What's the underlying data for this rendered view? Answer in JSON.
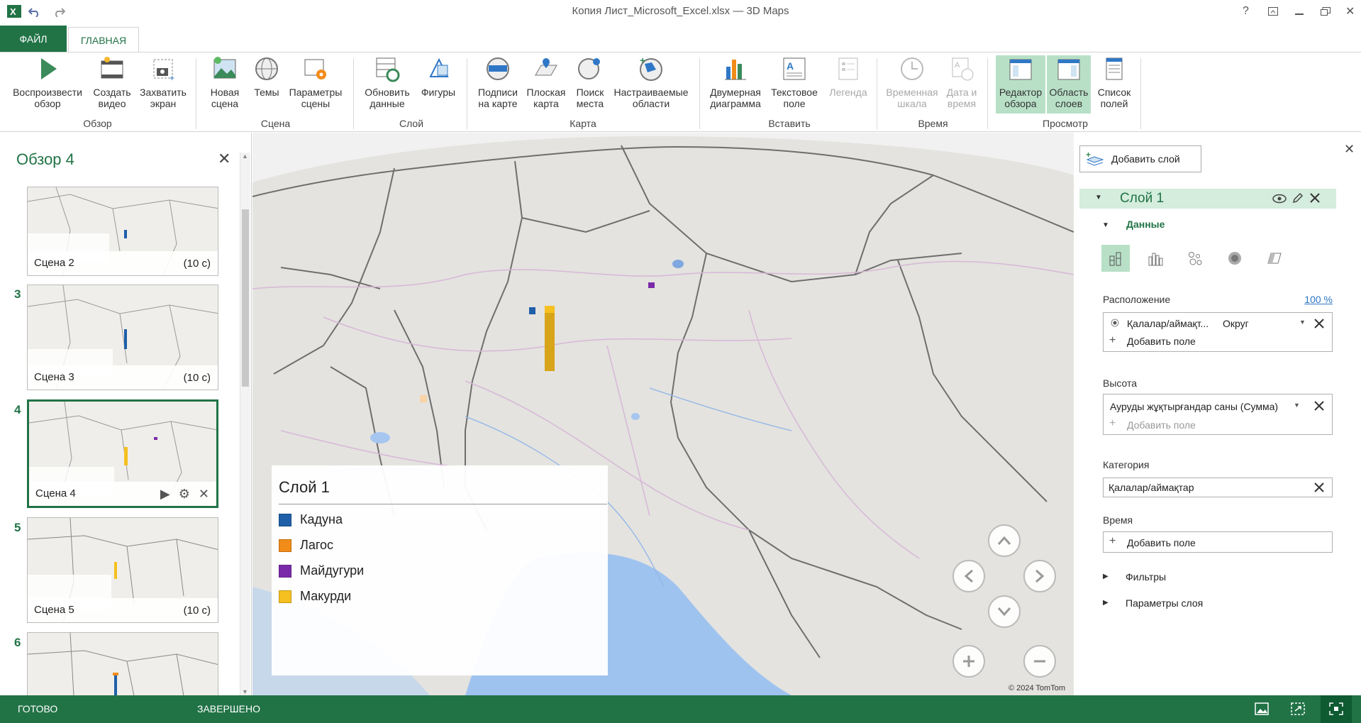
{
  "window": {
    "title": "Копия Лист_Microsoft_Excel.xlsx — 3D Maps"
  },
  "tabs": {
    "file": "ФАЙЛ",
    "home": "ГЛАВНАЯ"
  },
  "ribbon": {
    "play_tour": "Воспроизвести\nобзор",
    "create_video": "Создать\nвидео",
    "capture_screen": "Захватить\nэкран",
    "new_scene": "Новая\nсцена",
    "themes": "Темы",
    "scene_options": "Параметры\nсцены",
    "refresh_data": "Обновить\nданные",
    "shapes": "Фигуры",
    "map_labels": "Подписи\nна карте",
    "flat_map": "Плоская\nкарта",
    "find_location": "Поиск\nместа",
    "custom_regions": "Настраиваемые\nобласти",
    "chart_2d": "Двумерная\nдиаграмма",
    "text_box": "Текстовое\nполе",
    "legend": "Легенда",
    "timeline": "Временная\nшкала",
    "date_time": "Дата и\nвремя",
    "tour_editor": "Редактор\nобзора",
    "layer_pane": "Область\nслоев",
    "field_list": "Список\nполей",
    "groups": {
      "tour": "Обзор",
      "scene": "Сцена",
      "layer": "Слой",
      "map": "Карта",
      "insert": "Вставить",
      "time": "Время",
      "view": "Просмотр"
    }
  },
  "tour": {
    "title": "Обзор 4",
    "scenes": [
      {
        "num": "",
        "label": "Сцена 2",
        "duration": "(10 с)"
      },
      {
        "num": "3",
        "label": "Сцена 3",
        "duration": "(10 с)"
      },
      {
        "num": "4",
        "label": "Сцена 4",
        "duration": ""
      },
      {
        "num": "5",
        "label": "Сцена 5",
        "duration": "(10 с)"
      },
      {
        "num": "6",
        "label": "",
        "duration": ""
      }
    ]
  },
  "legend": {
    "title": "Слой 1",
    "items": [
      {
        "label": "Кадуна",
        "color": "#1f5fa8"
      },
      {
        "label": "Лагос",
        "color": "#f28c18"
      },
      {
        "label": "Майдугури",
        "color": "#7a2aa8"
      },
      {
        "label": "Макурди",
        "color": "#f5c020"
      }
    ]
  },
  "map": {
    "copyright": "© 2024 TomTom"
  },
  "layer_pane": {
    "add_layer": "Добавить слой",
    "layer_name": "Слой 1",
    "data_section": "Данные",
    "location_label": "Расположение",
    "location_pct": "100 %",
    "location_field": "Қалалар/аймақт...",
    "location_type": "Округ",
    "add_field": "Добавить поле",
    "height_label": "Высота",
    "height_field": "Ауруды жұқтырғандар саны (Сумма)",
    "category_label": "Категория",
    "category_field": "Қалалар/аймақтар",
    "time_label": "Время",
    "filters": "Фильтры",
    "layer_options": "Параметры слоя"
  },
  "status": {
    "ready": "ГОТОВО",
    "done": "ЗАВЕРШЕНО"
  }
}
